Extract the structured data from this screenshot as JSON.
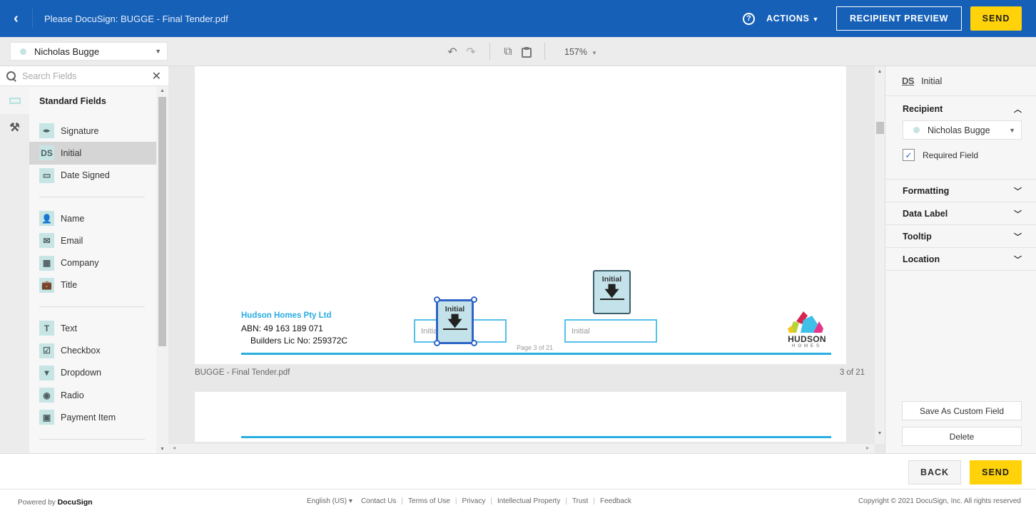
{
  "header": {
    "back_label": "‹",
    "title": "Please DocuSign: BUGGE - Final Tender.pdf",
    "help_icon": "?",
    "actions_label": "ACTIONS",
    "recipient_preview_label": "RECIPIENT PREVIEW",
    "send_label": "SEND"
  },
  "toolbar": {
    "recipient": "Nicholas Bugge",
    "undo_icon": "↶",
    "redo_icon": "↷",
    "copy_icon": "⧉",
    "paste_icon": "📋",
    "zoom": "157%"
  },
  "left_panel": {
    "search_placeholder": "Search Fields",
    "search_value": "",
    "heading": "Standard Fields",
    "groups": [
      [
        {
          "label": "Signature",
          "icon": "✒"
        },
        {
          "label": "Initial",
          "icon": "DS",
          "selected": true
        },
        {
          "label": "Date Signed",
          "icon": "▭"
        }
      ],
      [
        {
          "label": "Name",
          "icon": "👤"
        },
        {
          "label": "Email",
          "icon": "✉"
        },
        {
          "label": "Company",
          "icon": "▦"
        },
        {
          "label": "Title",
          "icon": "💼"
        }
      ],
      [
        {
          "label": "Text",
          "icon": "T"
        },
        {
          "label": "Checkbox",
          "icon": "☑"
        },
        {
          "label": "Dropdown",
          "icon": "▾"
        },
        {
          "label": "Radio",
          "icon": "◉"
        },
        {
          "label": "Payment Item",
          "icon": "▣"
        }
      ]
    ]
  },
  "document": {
    "company_name": "Hudson Homes Pty Ltd",
    "abn": "ABN: 49 163 189 071",
    "builders_lic": "Builders Lic No: 259372C",
    "page_label": "Page 3 of 21",
    "initial_placeholder": "Initial",
    "tag_label": "Initial",
    "logo_text": "HUDSON",
    "logo_sub": "HOMES",
    "file_name": "BUGGE - Final Tender.pdf",
    "page_counter": "3 of 21"
  },
  "right_panel": {
    "field_type": "Initial",
    "field_icon": "DS",
    "recipient_title": "Recipient",
    "recipient": "Nicholas Bugge",
    "required_label": "Required Field",
    "required_checked": true,
    "sections": [
      "Formatting",
      "Data Label",
      "Tooltip",
      "Location"
    ],
    "save_custom_label": "Save As Custom Field",
    "delete_label": "Delete"
  },
  "bottom_bar": {
    "back_label": "BACK",
    "send_label": "SEND"
  },
  "footer": {
    "powered_prefix": "Powered by",
    "powered_brand": "DocuSign",
    "language": "English (US) ▾",
    "links": [
      "Contact Us",
      "Terms of Use",
      "Privacy",
      "Intellectual Property",
      "Trust",
      "Feedback"
    ],
    "copyright": "Copyright © 2021 DocuSign, Inc. All rights reserved"
  },
  "colors": {
    "header_blue": "#1660b8",
    "send_yellow": "#ffd20a",
    "field_teal": "#c6e5e4",
    "selection_blue": "#2f64c6",
    "doc_accent": "#2aace2"
  }
}
